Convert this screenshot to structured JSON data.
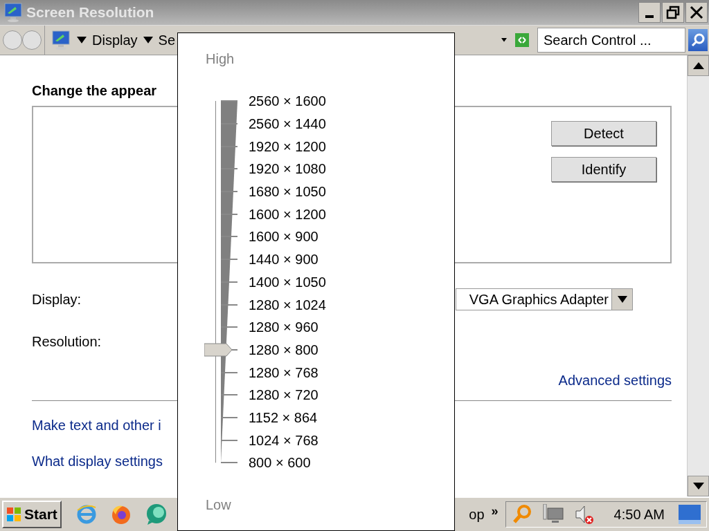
{
  "window": {
    "title": "Screen Resolution"
  },
  "toolbar": {
    "breadcrumb": [
      "Display",
      "Se"
    ],
    "search": {
      "placeholder": "Search Control ..."
    }
  },
  "content": {
    "heading": "Change the appear",
    "buttons": [
      "Detect",
      "Identify"
    ],
    "display": {
      "label": "Display:",
      "value": "VGA Graphics Adapter"
    },
    "resolution": {
      "label": "Resolution:"
    },
    "advanced_link": "Advanced settings",
    "links": [
      "Make text and other i",
      "What display settings"
    ]
  },
  "resolution_popup": {
    "high_label": "High",
    "low_label": "Low",
    "options": [
      {
        "label": "2560 × 1600",
        "selected": false
      },
      {
        "label": "2560 × 1440",
        "selected": false
      },
      {
        "label": "1920 × 1200",
        "selected": false
      },
      {
        "label": "1920 × 1080",
        "selected": false
      },
      {
        "label": "1680 × 1050",
        "selected": false
      },
      {
        "label": "1600 × 1200",
        "selected": false
      },
      {
        "label": "1600 × 900",
        "selected": false
      },
      {
        "label": "1440 × 900",
        "selected": false
      },
      {
        "label": "1400 × 1050",
        "selected": false
      },
      {
        "label": "1280 × 1024",
        "selected": false
      },
      {
        "label": "1280 × 960",
        "selected": false
      },
      {
        "label": "1280 × 800",
        "selected": true
      },
      {
        "label": "1280 × 768",
        "selected": false
      },
      {
        "label": "1280 × 720",
        "selected": false
      },
      {
        "label": "1152 × 864",
        "selected": false
      },
      {
        "label": "1024 × 768",
        "selected": false
      },
      {
        "label": "800 × 600",
        "selected": false
      }
    ]
  },
  "taskbar": {
    "start": "Start",
    "task_label": "op",
    "overflow": "»",
    "clock": "4:50 AM"
  }
}
